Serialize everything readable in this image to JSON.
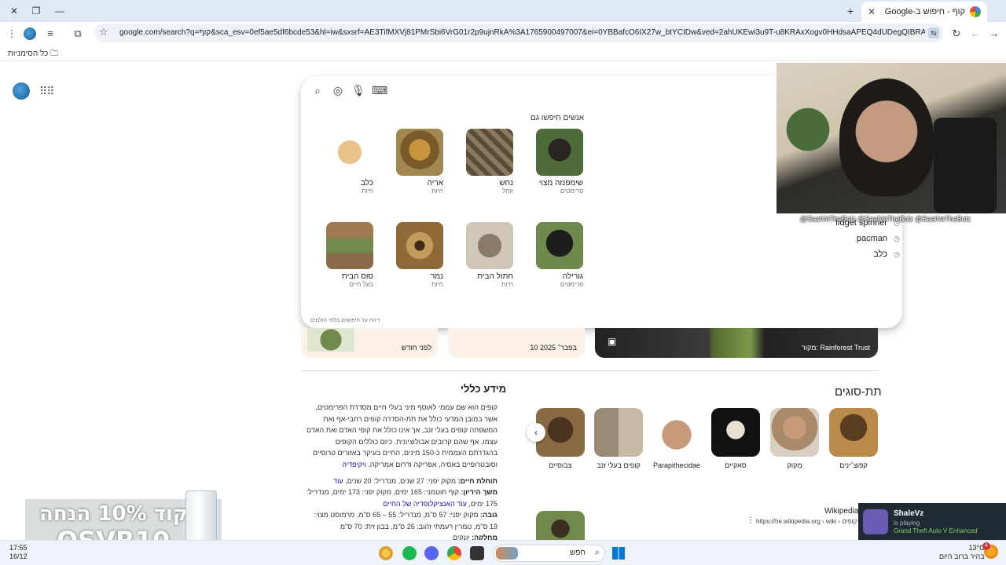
{
  "browser": {
    "tab_title": "קוף - חיפוש ב-Google",
    "url": "google.com/search?q=קוף&sca_esv=0ef5ae5df6bcde53&hl=iw&sxsrf=AE3TifMXVj81PMrSbi6VrG01r2p9ujnRkA%3A1765900497007&ei=0YBBafcO6IX27w_btYCIDw&ved=2ahUKEwi3u9T-u8KRAxXogv0HHdsaAPEQ4dUDegQIBRAN&uact=5&oq=קוף",
    "bookmarks_all": "כל הסימניות"
  },
  "search_panel": {
    "people_also_search": "אנשים חיפשו גם",
    "items": [
      {
        "name": "שימפנזה מצוי",
        "type": "פרימטים"
      },
      {
        "name": "נחש",
        "type": "זוחל"
      },
      {
        "name": "אריה",
        "type": "חיות"
      },
      {
        "name": "כלב",
        "type": "חיות"
      },
      {
        "name": "גורילה",
        "type": "פרימטים"
      },
      {
        "name": "חתול הבית",
        "type": "חיות"
      },
      {
        "name": "נמר",
        "type": "חיות"
      },
      {
        "name": "סוס הבית",
        "type": "בעל חיים"
      }
    ],
    "footer": "דיווח על חיפושים בלתי הולמים"
  },
  "recent_searches": [
    "fidget spinner",
    "pacman",
    "כלב"
  ],
  "overlay_tags": "@SaaiVeTheBolz  @SaaiVeTheBolz  @SaaiVeTheBolz",
  "strip": {
    "card1_date": "לפני חודש",
    "card2_date": "10 בפבר׳ 2025",
    "card3_source": "מקור: Rainforest Trust"
  },
  "info": {
    "title": "מידע כללי",
    "body": "קופים הוא שם עממי לאוסף מיני בעלי חיים מסדרת הפרימטים, אשר במובן המדעי כולל את תת-הסדרה קופים רחבי-אף ואת המשפחה קופים בעלי זנב, אך אינו כולל את קופי האדם ואת האדם עצמו, אף שהם קרובים אבולוציונית. כיום כוללים הקופים בהגדרתם העממית כ-150 מינים, החיים בעיקר באזורים טרופיים וסובטרופיים באסיה, אפריקה ודרום אמריקה.",
    "wiki_link": "ויקיפדיה",
    "facts": [
      {
        "label": "תוחלת חיים:",
        "text": "מקוק יפני: 27 שנים, מנדריל: 20 שנים,",
        "more": "עוד"
      },
      {
        "label": "משך היריון:",
        "text": "קוף חוטמני: 165 ימים, מקוק יפני: 173 ימים, מנדריל: 175 ימים,",
        "more": "עוד האנציקלופדיה של החיים"
      },
      {
        "label": "גובה:",
        "text": "מקוק יפני: 57 ס\"מ, מנדריל: 55 – 65 ס\"מ, מרמוסט מצוי: 19 ס\"מ, טמרין רעמתי זהוב: 26 ס\"מ, בבון זית: 70 ס\"מ",
        "more": ""
      },
      {
        "label": "מחלקה:",
        "text": "יונקים",
        "more": ""
      }
    ]
  },
  "subtypes": {
    "title": "תת-סוגים",
    "items": [
      "קפוצ׳ינים",
      "מקוק",
      "סאקיים",
      "Parapithecidae",
      "קופים בעלי זנב",
      "צבוסיים"
    ]
  },
  "wikipedia": {
    "name": "Wikipedia",
    "url": "https://he.wikipedia.org › wiki › קופים"
  },
  "promo": {
    "line1": "קוד 10% הנחה",
    "line2": "OSVR10"
  },
  "spotify": {
    "name": "ShaleVz",
    "status": "is playing",
    "game": "Grand Theft Auto V Enhanced"
  },
  "taskbar": {
    "time": "17:55",
    "date": "16/12",
    "search_label": "חפש",
    "temp": "13°C",
    "weather_desc": "בהיר ברוב היום",
    "notifications": "4"
  }
}
